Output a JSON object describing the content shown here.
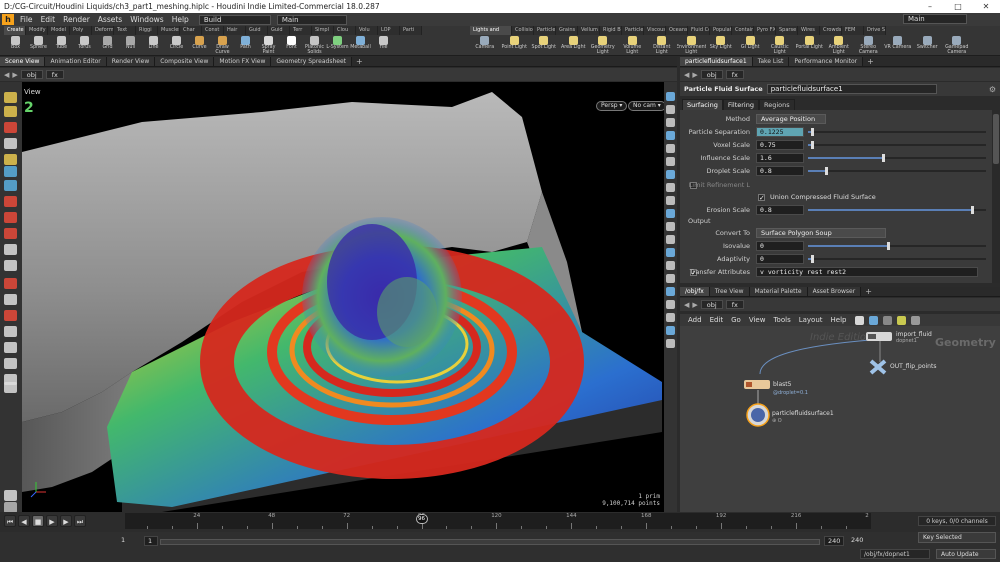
{
  "window": {
    "title": "D:/CG-Circuit/Houdini Liquids/ch3_part1_meshing.hiplc - Houdini Indie Limited-Commercial 18.0.287",
    "minimize": "–",
    "maximize": "□",
    "close": "✕"
  },
  "menubar": {
    "items": [
      "File",
      "Edit",
      "Render",
      "Assets",
      "Windows",
      "Help"
    ],
    "build_desktop": "Build",
    "main_desktop": "Main",
    "right_desktop": "Main"
  },
  "shelf": {
    "left_tabs": [
      "Create",
      "Modify",
      "Model",
      "Poly",
      "Deform",
      "Text",
      "Riggi",
      "Muscles",
      "Char",
      "Const",
      "Hair",
      "Guid",
      "Guid",
      "Terr",
      "Simpl",
      "Clou",
      "Volu",
      "LOP",
      "Parti"
    ],
    "left_tools": [
      "Box",
      "Sphere",
      "Tube",
      "Torus",
      "Grid",
      "Null",
      "Line",
      "Circle",
      "Curve",
      "Draw Curve",
      "Path",
      "Spray Paint",
      "Font",
      "Platonic Solids",
      "L-System",
      "Metaball",
      "File"
    ],
    "right_tabs": [
      "Lights and",
      "Collisions",
      "Particles",
      "Grains",
      "Vellum",
      "Rigid Bodies",
      "Particle Fl",
      "Viscous Fl",
      "Oceans",
      "Fluid Con",
      "Populate C",
      "Container",
      "Pyro FX",
      "Sparse Pyr",
      "Wires",
      "Crowds",
      "FEM",
      "Drive Sim"
    ],
    "right_tools": [
      "Camera",
      "Point Light",
      "Spot Light",
      "Area Light",
      "Geometry Light",
      "Volume Light",
      "Distant Light",
      "Environment Light",
      "Sky Light",
      "GI Light",
      "Caustic Light",
      "Portal Light",
      "Ambient Light",
      "Stereo Camera",
      "VR Camera",
      "Switcher",
      "Gamepad Camera"
    ]
  },
  "viewer": {
    "tabs": [
      "Scene View",
      "Animation Editor",
      "Render View",
      "Composite View",
      "Motion FX View",
      "Geometry Spreadsheet"
    ],
    "path": [
      "obj",
      "fx"
    ],
    "title": "View",
    "persp": "Persp ▾",
    "cam": "No cam ▾",
    "stats_line1": "1  prim",
    "stats_line2": "9,100,714 points"
  },
  "params": {
    "tabs": [
      "particlefluidsurface1",
      "Take List",
      "Performance Monitor"
    ],
    "path": [
      "obj",
      "fx"
    ],
    "node_type": "Particle Fluid Surface",
    "node_name": "particlefluidsurface1",
    "subtabs": [
      "Surfacing",
      "Filtering",
      "Regions"
    ],
    "method_label": "Method",
    "method_value": "Average Position",
    "particle_sep_label": "Particle Separation",
    "particle_sep_value": "0.1225",
    "voxel_label": "Voxel Scale",
    "voxel_value": "0.75",
    "influence_label": "Influence Scale",
    "influence_value": "1.6",
    "droplet_label": "Droplet Scale",
    "droplet_value": "0.8",
    "limit_label": "Limit Refinement L",
    "union_label": "Union Compressed Fluid Surface",
    "erosion_label": "Erosion Scale",
    "erosion_value": "0.8",
    "output_label": "Output",
    "convert_label": "Convert To",
    "convert_value": "Surface Polygon Soup",
    "isovalue_label": "Isovalue",
    "isovalue_value": "0",
    "adaptivity_label": "Adaptivity",
    "adaptivity_value": "0",
    "transfer_label": "Transfer Attributes",
    "transfer_value": "v vorticity rest rest2",
    "sliders": {
      "particle_sep": 0.02,
      "voxel": 0.02,
      "influence": 0.42,
      "droplet": 0.1,
      "erosion": 0.92,
      "isovalue": 0.45,
      "adaptivity": 0.02
    }
  },
  "network": {
    "tabs": [
      "/obj/fx",
      "Tree View",
      "Material Palette",
      "Asset Browser"
    ],
    "path": [
      "obj",
      "fx"
    ],
    "menu": [
      "Add",
      "Edit",
      "Go",
      "View",
      "Tools",
      "Layout",
      "Help"
    ],
    "watermark1": "Indie Edition",
    "watermark2": "Geometry",
    "nodes": {
      "dopimport": "import_fluid",
      "dopimport_suffix": "dopnet1",
      "out": "OUT_flip_points",
      "blast": "blast5",
      "blast_sub": "@droplet=0.1",
      "pfs": "particlefluidsurface1",
      "pfs_sub": "⊕ O"
    }
  },
  "timeline": {
    "ticks": [
      24,
      48,
      72,
      96,
      120,
      144,
      168,
      192,
      216,
      2
    ],
    "current_frame": "96",
    "keys_channels": "0 keys, 0/0 channels",
    "key_mode": "Key Selected",
    "start": "1",
    "start2": "1",
    "end": "240",
    "end2": "240",
    "status_path": "/obj/fx/dopnet1",
    "auto_update": "Auto Update"
  },
  "colors": {
    "houdini_orange": "#f7a21b",
    "selected_field": "#5fa4b2",
    "slider_fill": "#5a7fb6"
  }
}
